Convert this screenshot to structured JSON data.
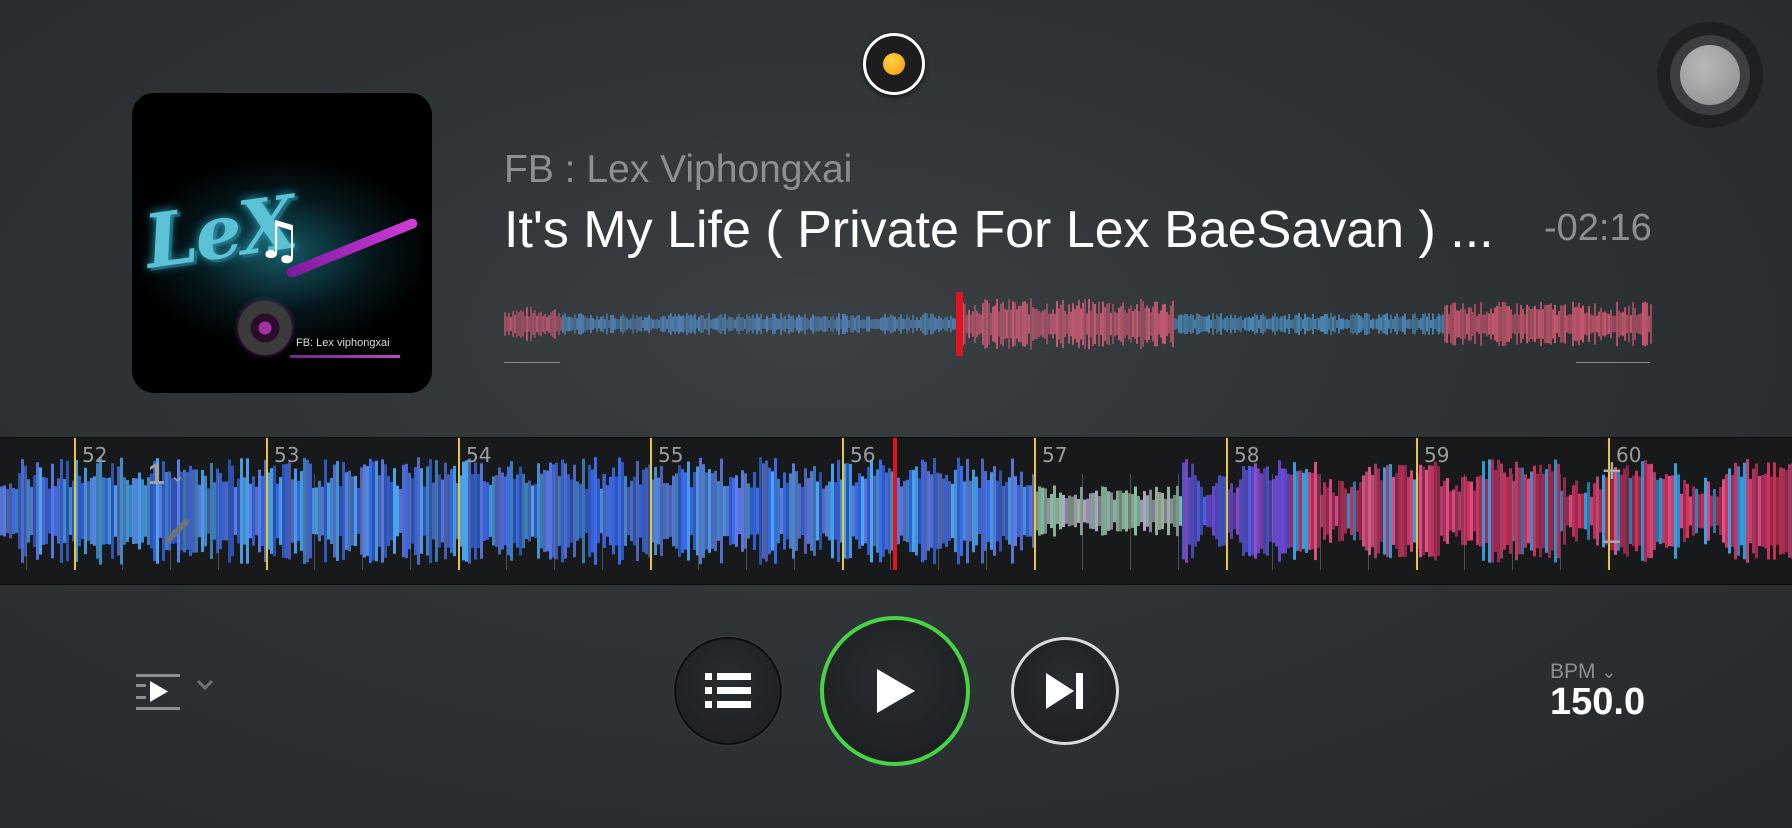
{
  "track": {
    "artist": "FB : Lex Viphongxai",
    "title": "It's My Life ( Private For Lex BaeSavan ) ...",
    "time_remaining": "-02:16"
  },
  "album_art": {
    "logo_text": "LeX",
    "caption": "FB: Lex viphongxai"
  },
  "waveform": {
    "beat_markers": [
      "52",
      "53",
      "54",
      "55",
      "56",
      "57",
      "58",
      "59",
      "60"
    ],
    "loop_size": "1"
  },
  "controls": {
    "bpm_label": "BPM",
    "bpm_value": "150.0"
  },
  "colors": {
    "play_ring": "#47d443",
    "beat_marker": "#e8c63a",
    "playhead": "#e0141e",
    "deck_indicator": "#f59a00"
  },
  "icons": {
    "deck": "deck-indicator-icon",
    "playlist": "list-icon",
    "play": "play-icon",
    "next": "skip-next-icon",
    "sync": "sync-icon",
    "assistive": "assistive-touch-icon"
  }
}
